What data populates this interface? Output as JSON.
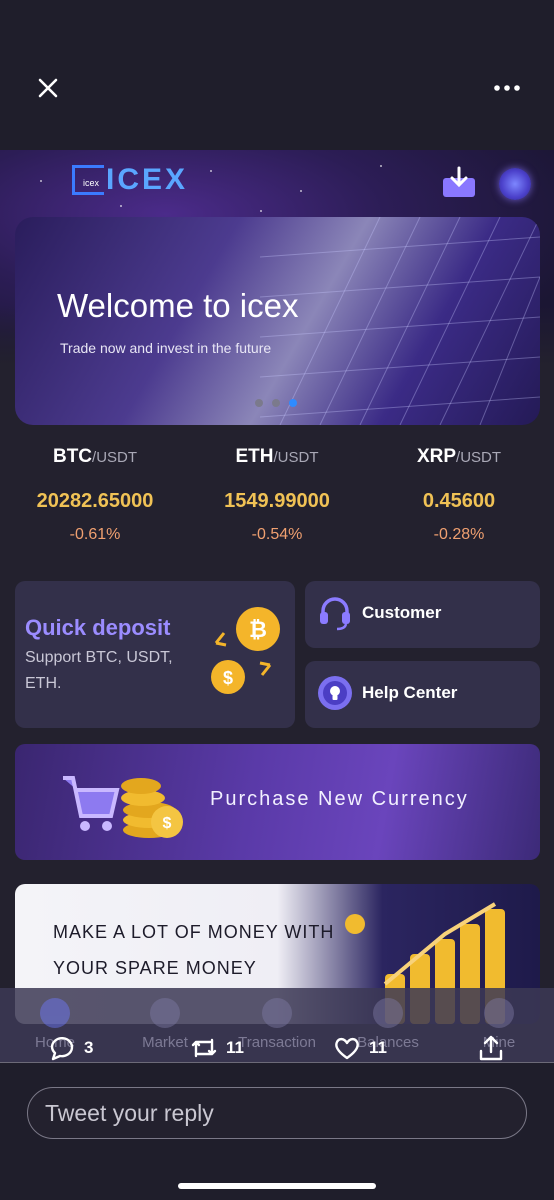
{
  "app": {
    "logo_text": "ICEX",
    "logo_mark_text": "icex",
    "banner": {
      "title": "Welcome to icex",
      "subtitle": "Trade now and invest in the future"
    },
    "tickers": [
      {
        "base": "BTC",
        "quote": "/USDT",
        "price": "20282.65000",
        "change": "-0.61%"
      },
      {
        "base": "ETH",
        "quote": "/USDT",
        "price": "1549.99000",
        "change": "-0.54%"
      },
      {
        "base": "XRP",
        "quote": "/USDT",
        "price": "0.45600",
        "change": "-0.28%"
      }
    ],
    "quick_deposit": {
      "title": "Quick deposit",
      "subtitle": "Support BTC, USDT, ETH."
    },
    "customer_label": "Customer",
    "help_center_label": "Help Center",
    "purchase_label": "Purchase New Currency",
    "promo": {
      "line1": "MAKE A LOT OF MONEY WITH",
      "line2": "YOUR SPARE MONEY"
    },
    "nav": [
      "Home",
      "Market",
      "Transaction",
      "Balances",
      "Mine"
    ]
  },
  "tweet": {
    "replies": "3",
    "retweets": "11",
    "likes": "11",
    "reply_placeholder": "Tweet your reply"
  },
  "colors": {
    "accent_gold": "#f0c255",
    "change_orange": "#f0a070",
    "brand_purple": "#9b8cff",
    "active_dot": "#2e8bff"
  }
}
